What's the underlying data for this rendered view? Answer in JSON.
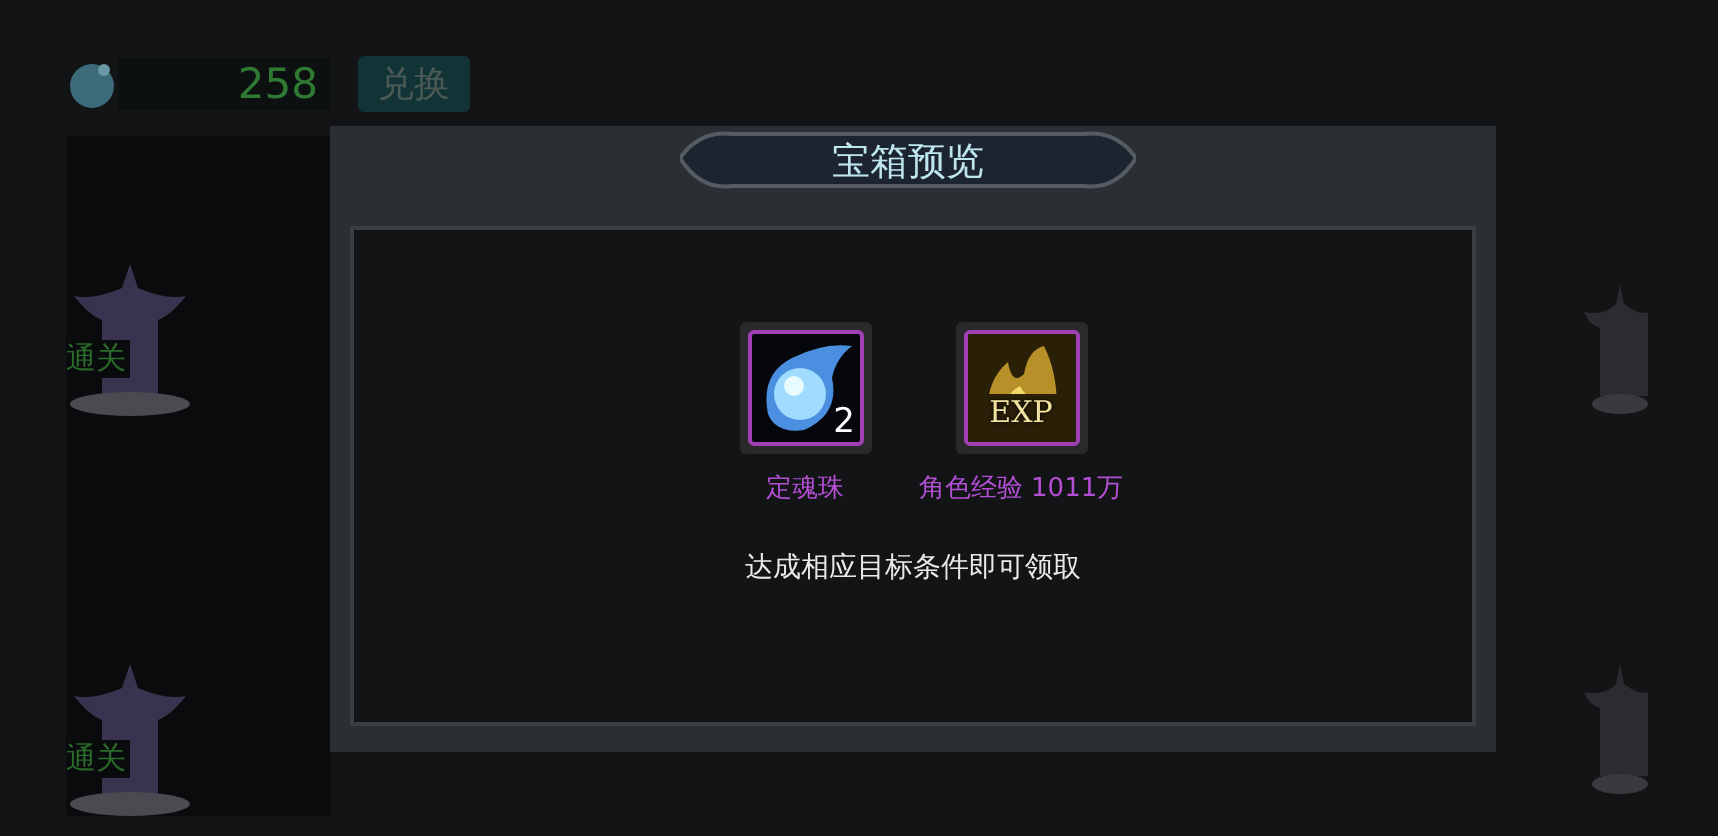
{
  "currency": {
    "amount": "258"
  },
  "exchange_button": {
    "label": "兑换"
  },
  "stages": [
    {
      "label": "通关"
    },
    {
      "label": "通关"
    }
  ],
  "dialog": {
    "title": "宝箱预览",
    "rewards": [
      {
        "kind": "orb",
        "name": "定魂珠",
        "count": "2"
      },
      {
        "kind": "exp",
        "name": "角色经验 1011万",
        "badge": "EXP"
      }
    ],
    "note": "达成相应目标条件即可领取"
  }
}
